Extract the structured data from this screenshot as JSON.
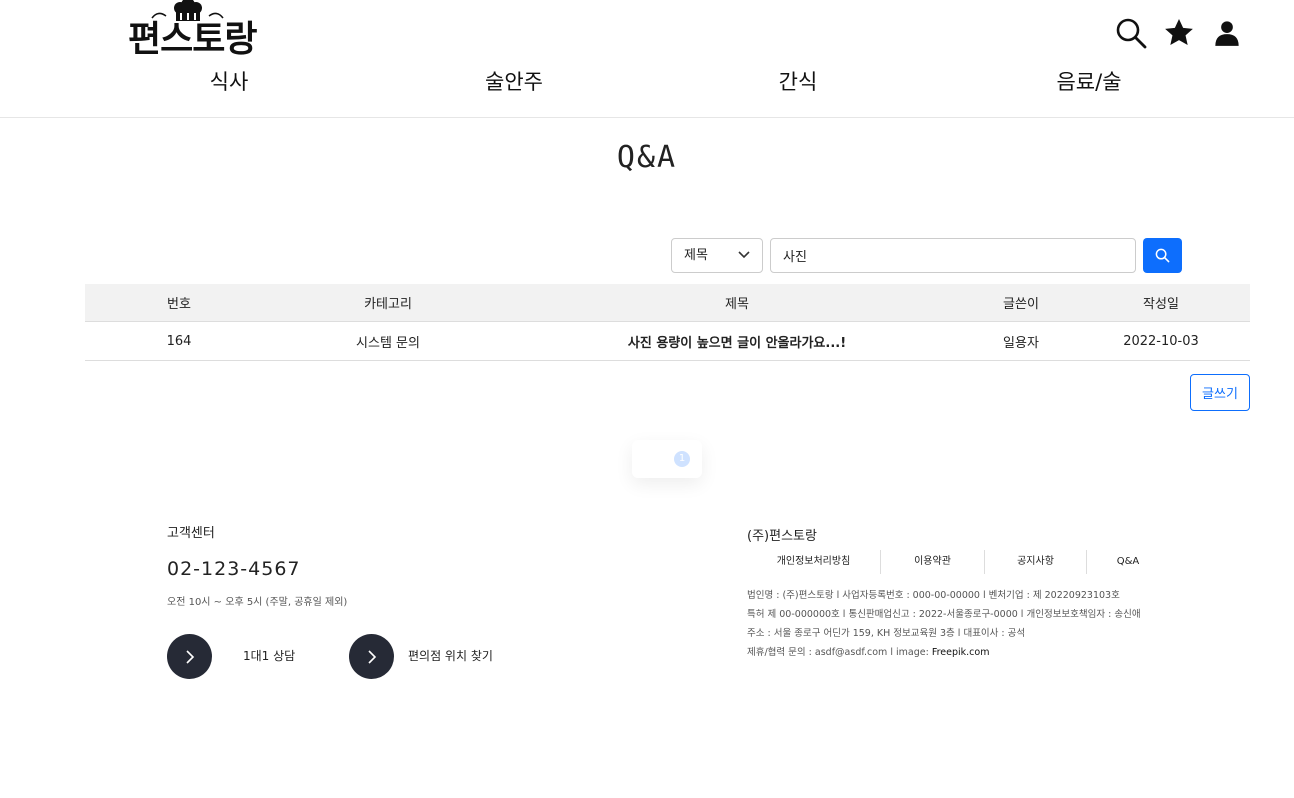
{
  "header": {
    "logo_text": "편스토랑",
    "nav": [
      {
        "label": "식사"
      },
      {
        "label": "술안주"
      },
      {
        "label": "간식"
      },
      {
        "label": "음료/술"
      }
    ],
    "icons": [
      "search-icon",
      "star-icon",
      "user-icon"
    ]
  },
  "page": {
    "title": "Q&A"
  },
  "search": {
    "select_value": "제목",
    "input_value": "사진"
  },
  "table": {
    "headers": [
      "번호",
      "카테고리",
      "제목",
      "글쓴이",
      "작성일"
    ],
    "rows": [
      {
        "no": "164",
        "category": "시스템 문의",
        "title": "사진 용량이 높으면 글이 안올라가요...!",
        "author": "일용자",
        "date": "2022-10-03"
      }
    ]
  },
  "write_button": "글쓰기",
  "pagination": {
    "current": "1"
  },
  "footer": {
    "cs_title": "고객센터",
    "phone": "02-123-4567",
    "hours": "오전 10시 ~ 오후 5시 (주말, 공휴일 제외)",
    "btn1": "1대1 상담",
    "btn2": "편의점 위치 찾기",
    "company": "(주)편스토랑",
    "links": [
      "개인정보처리방침",
      "이용약관",
      "공지사항",
      "Q&A"
    ],
    "info1": "법인명 : (주)편스토랑 l 사업자등록번호 : 000-00-00000 l 벤처기업 : 제 20220923103호",
    "info2": "특허 제 00-000000호 l 통신판매업신고 : 2022-서울종로구-0000 l 개인정보보호책임자 : 송신애",
    "info3": "주소 : 서울 종로구 어딘가 159, KH 정보교육원 3층 l 대표이사 : 공석",
    "info4_prefix": "제휴/협력 문의 : asdf@asdf.com l image: ",
    "info4_link": "Freepik.com"
  },
  "colors": {
    "primary": "#0d6efd",
    "dark_button": "#262a36"
  }
}
